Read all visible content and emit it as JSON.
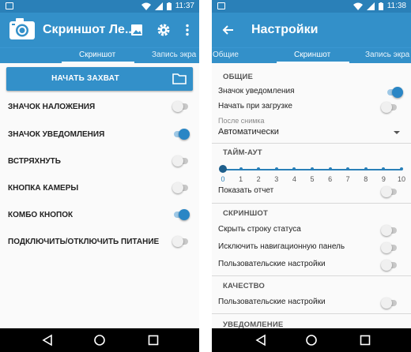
{
  "left": {
    "status": {
      "time": "11:37"
    },
    "appbar": {
      "title": "Скриншот Ле..."
    },
    "tabs": [
      "Скриншот",
      "Запись экра"
    ],
    "capture_button": "НАЧАТЬ ЗАХВАТ",
    "settings": [
      {
        "label": "ЗНАЧОК НАЛОЖЕНИЯ",
        "on": false
      },
      {
        "label": "ЗНАЧОК УВЕДОМЛЕНИЯ",
        "on": true
      },
      {
        "label": "ВСТРЯХНУТЬ",
        "on": false
      },
      {
        "label": "КНОПКА КАМЕРЫ",
        "on": false
      },
      {
        "label": "КОМБО КНОПОК",
        "on": true
      },
      {
        "label": "ПОДКЛЮЧИТЬ/ОТКЛЮЧИТЬ ПИТАНИЕ",
        "on": false
      }
    ]
  },
  "right": {
    "status": {
      "time": "11:38"
    },
    "appbar": {
      "title": "Настройки"
    },
    "tabs": [
      "Общие",
      "Скриншот",
      "Запись экра"
    ],
    "sections": {
      "general": "ОБЩИЕ",
      "timeout": "ТАЙМ-АУТ",
      "screenshot": "СКРИНШОТ",
      "quality": "КАЧЕСТВО",
      "next": "УВЕДОМЛЕНИЕ"
    },
    "general": {
      "notification_icon": {
        "label": "Значок уведомления",
        "on": true
      },
      "start_on_boot": {
        "label": "Начать при загрузке",
        "on": false
      },
      "after_capture_label": "После снимка",
      "after_capture_value": "Автоматически"
    },
    "timeout": {
      "ticks": [
        "0",
        "1",
        "2",
        "3",
        "4",
        "5",
        "6",
        "7",
        "8",
        "9",
        "10"
      ],
      "value": 0,
      "show_report": {
        "label": "Показать отчет",
        "on": false
      }
    },
    "screenshot": {
      "hide_status_bar": {
        "label": "Скрыть строку статуса",
        "on": false
      },
      "exclude_nav_bar": {
        "label": "Исключить навигационную панель",
        "on": false
      },
      "custom_settings": {
        "label": "Пользовательские настройки",
        "on": false
      }
    },
    "quality": {
      "custom_settings": {
        "label": "Пользовательские настройки",
        "on": false
      }
    }
  },
  "colors": {
    "primary": "#3390c9",
    "status_bar": "#2a80b8",
    "accent": "#2a86c5"
  }
}
